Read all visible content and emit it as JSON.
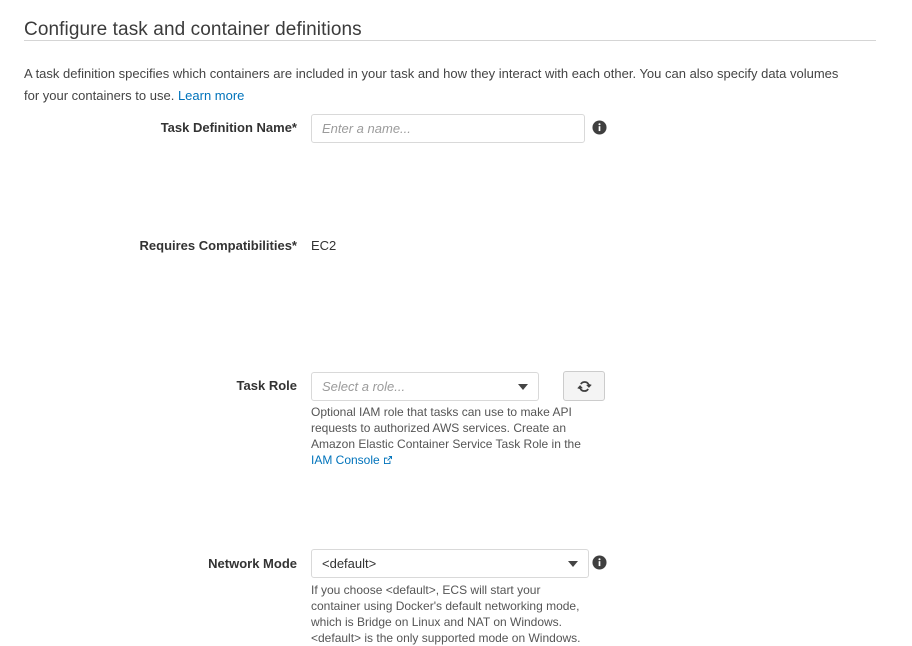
{
  "header": {
    "title": "Configure task and container definitions",
    "intro_text": "A task definition specifies which containers are included in your task and how they interact with each other. You can also specify data volumes for your containers to use.",
    "learn_more_label": "Learn more"
  },
  "colors": {
    "link": "#0073bb",
    "text": "#333333",
    "help_text": "#555555",
    "border": "#d9d9d9",
    "button_bg": "#f4f4f4",
    "rule": "#d5d5d5"
  },
  "form": {
    "task_definition_name": {
      "label": "Task Definition Name*",
      "placeholder": "Enter a name...",
      "value": "",
      "info_icon": "info-icon"
    },
    "requires_compatibilities": {
      "label": "Requires Compatibilities*",
      "value": "EC2"
    },
    "task_role": {
      "label": "Task Role",
      "selected": "Select a role...",
      "is_placeholder": true,
      "caret_icon": "chevron-down-icon",
      "refresh_icon": "refresh-icon",
      "help_text": "Optional IAM role that tasks can use to make API requests to authorized AWS services. Create an Amazon Elastic Container Service Task Role in the ",
      "help_link_label": "IAM Console",
      "external_link_icon": "external-link-icon"
    },
    "network_mode": {
      "label": "Network Mode",
      "selected": "<default>",
      "caret_icon": "chevron-down-icon",
      "info_icon": "info-icon",
      "help_text": "If you choose <default>, ECS will start your container using Docker's default networking mode, which is Bridge on Linux and NAT on Windows. <default> is the only supported mode on Windows."
    }
  }
}
